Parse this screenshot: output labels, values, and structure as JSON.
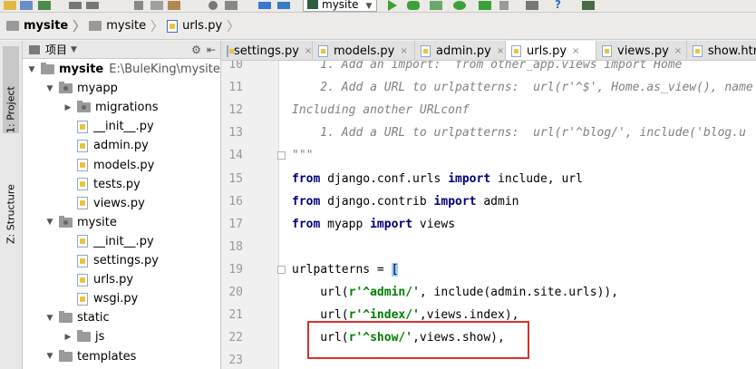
{
  "run_config": "mysite",
  "breadcrumb": [
    {
      "label": "mysite",
      "bold": true,
      "icon": "folder-icon"
    },
    {
      "label": "mysite",
      "bold": false,
      "icon": "folder-icon"
    },
    {
      "label": "urls.py",
      "bold": false,
      "icon": "python-file-icon"
    }
  ],
  "side_tabs": {
    "project": "1: Project",
    "structure": "Z: Structure"
  },
  "project_panel": {
    "title": "项目",
    "tree": [
      {
        "label": "mysite",
        "path": "E:\\BuleKing\\mysite",
        "depth": 0,
        "kind": "folder",
        "expanded": true
      },
      {
        "label": "myapp",
        "depth": 1,
        "kind": "package",
        "expanded": true
      },
      {
        "label": "migrations",
        "depth": 2,
        "kind": "package",
        "expanded": false
      },
      {
        "label": "__init__.py",
        "depth": 2,
        "kind": "file"
      },
      {
        "label": "admin.py",
        "depth": 2,
        "kind": "file"
      },
      {
        "label": "models.py",
        "depth": 2,
        "kind": "file"
      },
      {
        "label": "tests.py",
        "depth": 2,
        "kind": "file"
      },
      {
        "label": "views.py",
        "depth": 2,
        "kind": "file"
      },
      {
        "label": "mysite",
        "depth": 1,
        "kind": "package",
        "expanded": true
      },
      {
        "label": "__init__.py",
        "depth": 2,
        "kind": "file"
      },
      {
        "label": "settings.py",
        "depth": 2,
        "kind": "file"
      },
      {
        "label": "urls.py",
        "depth": 2,
        "kind": "file"
      },
      {
        "label": "wsgi.py",
        "depth": 2,
        "kind": "file"
      },
      {
        "label": "static",
        "depth": 1,
        "kind": "folder",
        "expanded": true
      },
      {
        "label": "js",
        "depth": 2,
        "kind": "folder",
        "expanded": false
      },
      {
        "label": "templates",
        "depth": 1,
        "kind": "folder",
        "expanded": true
      }
    ]
  },
  "tabs": [
    {
      "label": "settings.py",
      "active": false
    },
    {
      "label": "models.py",
      "active": false
    },
    {
      "label": "admin.py",
      "active": false
    },
    {
      "label": "urls.py",
      "active": true
    },
    {
      "label": "views.py",
      "active": false
    },
    {
      "label": "show.html",
      "active": false
    }
  ],
  "code_lines": [
    {
      "n": "10",
      "parts": [
        {
          "t": "    1. Add an import:  from other_app.views import Home",
          "c": "cmt"
        }
      ]
    },
    {
      "n": "11",
      "parts": [
        {
          "t": "    2. Add a URL to urlpatterns:  url(r'^$', Home.as_view(), name",
          "c": "cmt"
        }
      ]
    },
    {
      "n": "12",
      "parts": [
        {
          "t": "Including another URLconf",
          "c": "cmt"
        }
      ]
    },
    {
      "n": "13",
      "parts": [
        {
          "t": "    1. Add a URL to urlpatterns:  url(r'^blog/', include('blog.u",
          "c": "cmt"
        }
      ]
    },
    {
      "n": "14",
      "parts": [
        {
          "t": "\"\"\"",
          "c": "cmt"
        }
      ]
    },
    {
      "n": "15",
      "parts": [
        {
          "t": "from",
          "c": "kw"
        },
        {
          "t": " django.conf.urls ",
          "c": ""
        },
        {
          "t": "import",
          "c": "kw"
        },
        {
          "t": " include, url",
          "c": ""
        }
      ]
    },
    {
      "n": "16",
      "parts": [
        {
          "t": "from",
          "c": "kw"
        },
        {
          "t": " django.contrib ",
          "c": ""
        },
        {
          "t": "import",
          "c": "kw"
        },
        {
          "t": " admin",
          "c": ""
        }
      ]
    },
    {
      "n": "17",
      "parts": [
        {
          "t": "from",
          "c": "kw"
        },
        {
          "t": " myapp ",
          "c": ""
        },
        {
          "t": "import",
          "c": "kw"
        },
        {
          "t": " views",
          "c": ""
        }
      ]
    },
    {
      "n": "18",
      "parts": []
    },
    {
      "n": "19",
      "parts": [
        {
          "t": "urlpatterns = ",
          "c": ""
        },
        {
          "t": "[",
          "c": "bracket"
        }
      ]
    },
    {
      "n": "20",
      "parts": [
        {
          "t": "    url(",
          "c": ""
        },
        {
          "t": "r'^admin/'",
          "c": "str"
        },
        {
          "t": ", include(admin.site.urls)),",
          "c": ""
        }
      ]
    },
    {
      "n": "21",
      "parts": [
        {
          "t": "    url(",
          "c": ""
        },
        {
          "t": "r'^index/'",
          "c": "str"
        },
        {
          "t": ",views.index),",
          "c": ""
        }
      ]
    },
    {
      "n": "22",
      "parts": [
        {
          "t": "    url(",
          "c": ""
        },
        {
          "t": "r'^show/'",
          "c": "str"
        },
        {
          "t": ",views.show),",
          "c": ""
        }
      ]
    },
    {
      "n": "23",
      "parts": []
    }
  ]
}
